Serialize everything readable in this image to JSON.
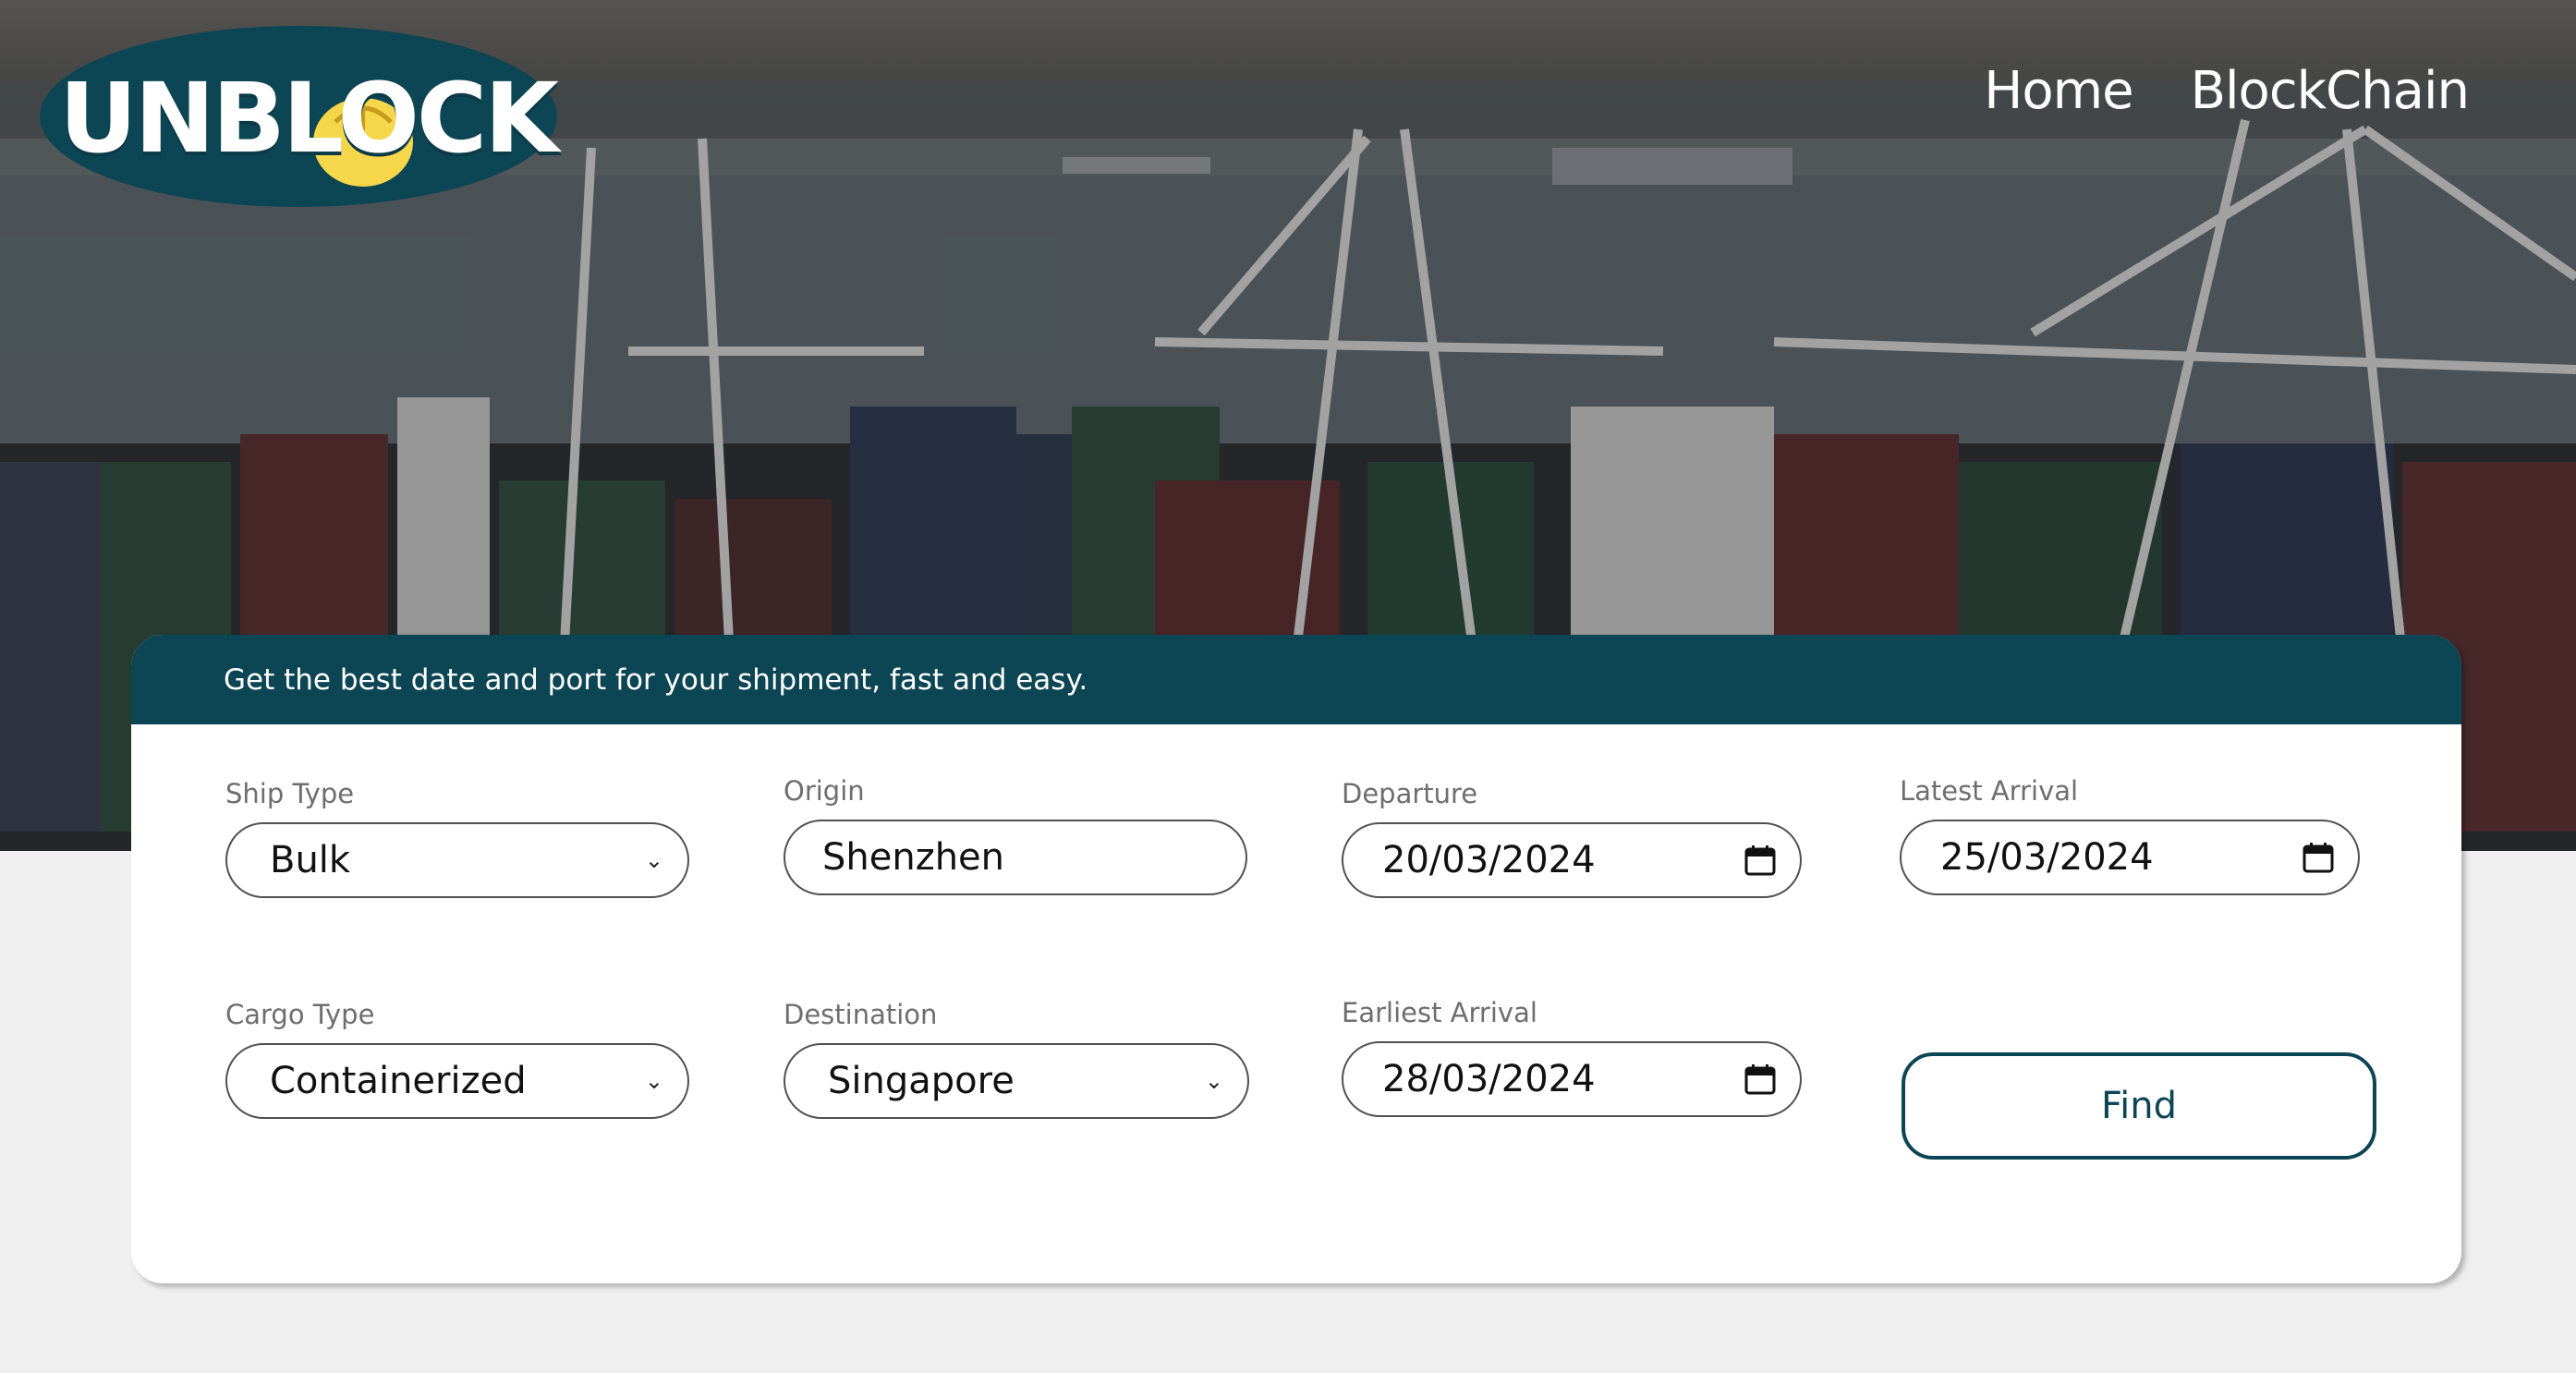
{
  "brand": {
    "logo_text": "UNBLOCK",
    "logo_bg": "#0c4553",
    "logo_coin": "#f6d64a"
  },
  "nav": {
    "items": [
      {
        "label": "Home"
      },
      {
        "label": "BlockChain"
      }
    ]
  },
  "search": {
    "header": "Get the best date and port for your shipment, fast and easy.",
    "ship_type": {
      "label": "Ship Type",
      "value": "Bulk"
    },
    "origin": {
      "label": "Origin",
      "value": "Shenzhen"
    },
    "departure": {
      "label": "Departure",
      "value": "20/03/2024"
    },
    "latest_arrival": {
      "label": "Latest Arrival",
      "value": "25/03/2024"
    },
    "cargo_type": {
      "label": "Cargo Type",
      "value": "Containerized"
    },
    "destination": {
      "label": "Destination",
      "value": "Singapore"
    },
    "earliest_arrival": {
      "label": "Earliest Arrival",
      "value": "28/03/2024"
    },
    "find_label": "Find"
  },
  "colors": {
    "accent": "#0c4553",
    "page_bg": "#efefef"
  },
  "icons": {
    "select": "chevron-down-icon",
    "date": "calendar-icon"
  }
}
